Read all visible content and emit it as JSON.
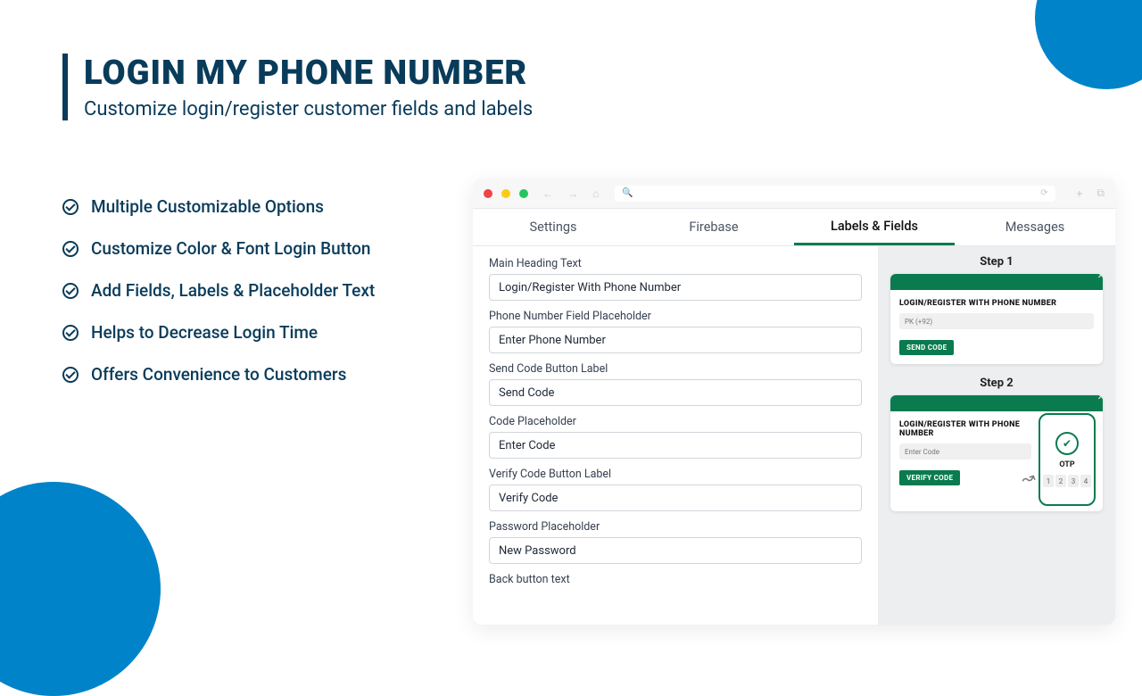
{
  "hero": {
    "title": "LOGIN MY PHONE NUMBER",
    "subtitle": "Customize login/register customer fields and labels"
  },
  "features": [
    "Multiple Customizable Options",
    "Customize Color & Font Login Button",
    "Add Fields, Labels & Placeholder Text",
    "Helps to Decrease Login Time",
    "Offers Convenience to Customers"
  ],
  "tabs": [
    "Settings",
    "Firebase",
    "Labels & Fields",
    "Messages"
  ],
  "active_tab": 2,
  "fields": [
    {
      "label": "Main Heading Text",
      "value": "Login/Register With Phone Number"
    },
    {
      "label": "Phone Number Field Placeholder",
      "value": "Enter Phone Number"
    },
    {
      "label": "Send Code Button Label",
      "value": "Send Code"
    },
    {
      "label": "Code Placeholder",
      "value": "Enter Code"
    },
    {
      "label": "Verify Code Button Label",
      "value": "Verify Code"
    },
    {
      "label": "Password Placeholder",
      "value": "New Password"
    },
    {
      "label": "Back button text",
      "value": ""
    }
  ],
  "preview": {
    "step1_label": "Step 1",
    "step2_label": "Step 2",
    "card_title": "LOGIN/REGISTER WITH PHONE NUMBER",
    "pk": "PK (+92)",
    "send_code": "SEND CODE",
    "enter_code": "Enter Code",
    "verify_code": "VERIFY CODE",
    "otp": "OTP",
    "digits": [
      "1",
      "2",
      "3",
      "4"
    ]
  }
}
